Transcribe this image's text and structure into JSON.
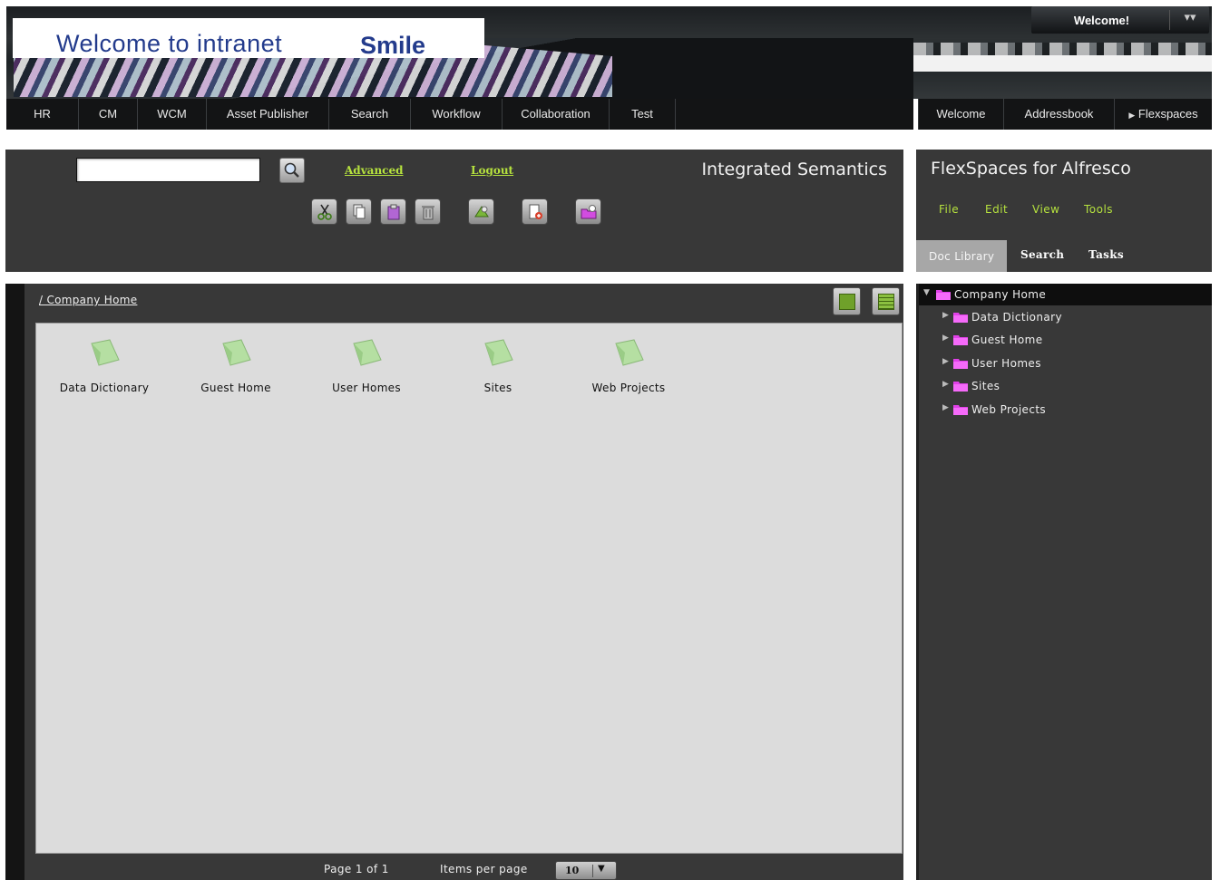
{
  "banner": {
    "title": "Welcome to intranet",
    "brand": "Smile",
    "welcome_label": "Welcome!"
  },
  "nav": {
    "items": [
      "HR",
      "CM",
      "WCM",
      "Asset Publisher",
      "Search",
      "Workflow",
      "Collaboration",
      "Test"
    ],
    "right_items": [
      "Welcome",
      "Addressbook",
      "Flexspaces"
    ]
  },
  "toolbar": {
    "search_value": "",
    "advanced_label": "Advanced",
    "logout_label": "Logout",
    "app_title": "Integrated Semantics",
    "buttons": [
      "cut-icon",
      "copy-icon",
      "paste-icon",
      "delete-icon",
      "properties-icon",
      "new-document-icon",
      "new-folder-icon"
    ]
  },
  "browse": {
    "breadcrumb": "/ Company Home",
    "folders": [
      "Data Dictionary",
      "Guest Home",
      "User Homes",
      "Sites",
      "Web Projects"
    ],
    "paging": {
      "page_text": "Page 1 of 1",
      "items_per_page_label": "Items per page",
      "items_per_page_value": "10"
    }
  },
  "flexspaces": {
    "title": "FlexSpaces for Alfresco",
    "menu": [
      "File",
      "Edit",
      "View",
      "Tools"
    ],
    "tabs": [
      "Doc Library",
      "Search",
      "Tasks"
    ],
    "tree": {
      "root": "Company Home",
      "children": [
        "Data Dictionary",
        "Guest Home",
        "User Homes",
        "Sites",
        "Web Projects"
      ]
    }
  },
  "colors": {
    "link_green": "#b6e23e",
    "panel_bg": "#383838",
    "folder_pink": "#e040e8"
  }
}
